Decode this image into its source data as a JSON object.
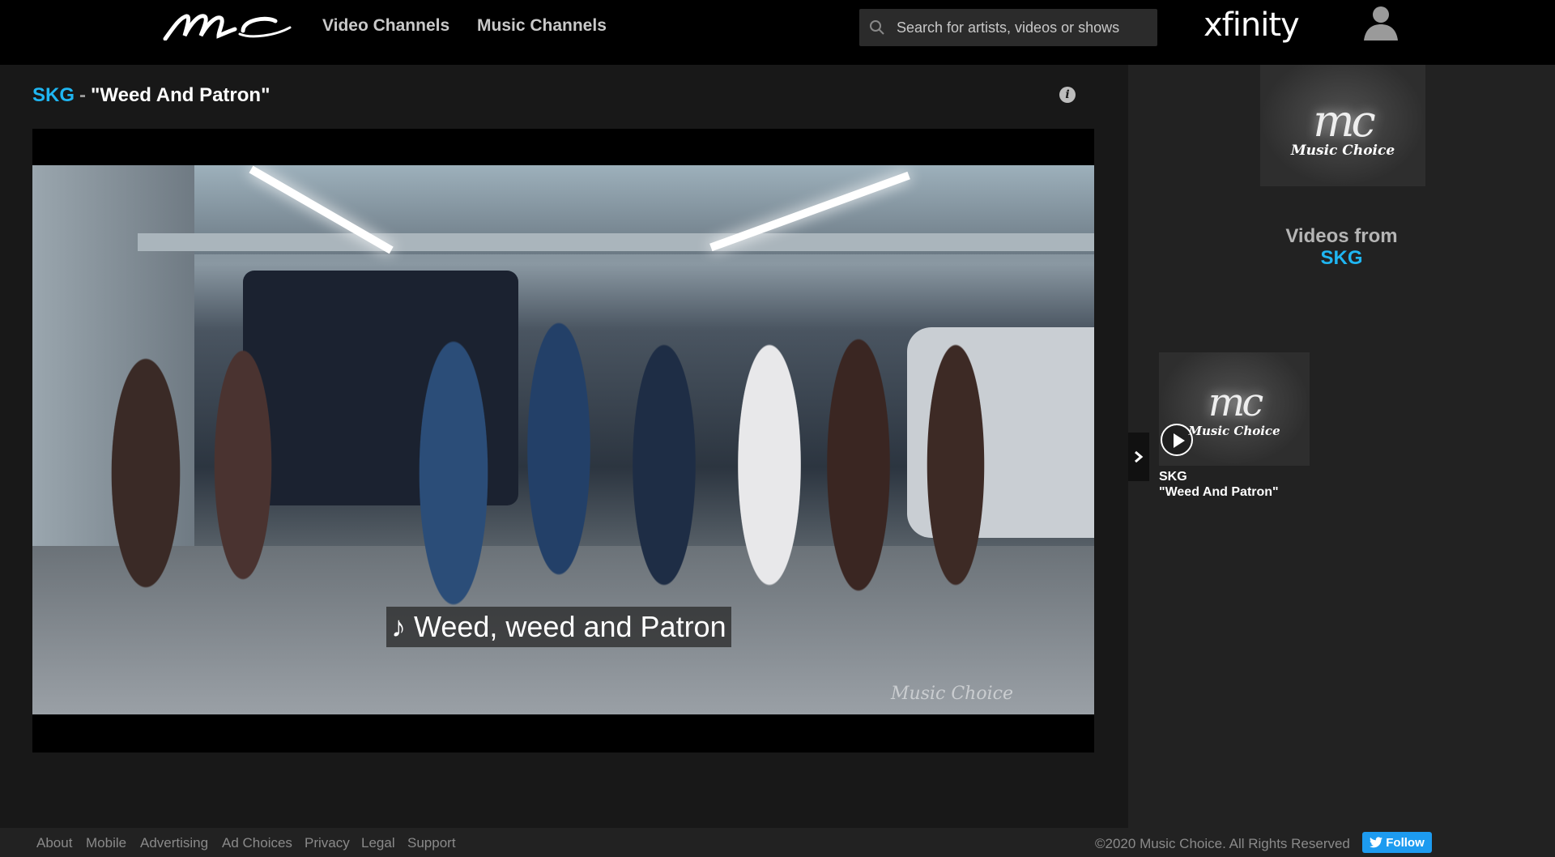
{
  "header": {
    "logo_text": "mc",
    "nav": [
      {
        "label": "Video Channels"
      },
      {
        "label": "Music Channels"
      }
    ],
    "search": {
      "placeholder": "Search for artists, videos or shows",
      "value": ""
    },
    "brand": "xfinity",
    "icons": {
      "search": "search-icon",
      "profile": "user-icon"
    }
  },
  "main": {
    "artist": "SKG",
    "separator": "-",
    "song_title": "\"Weed And Patron\"",
    "info_icon": "i",
    "player": {
      "caption": "♪ Weed, weed and Patron",
      "watermark": "Music Choice"
    }
  },
  "sidebar": {
    "top_card": {
      "logo": "mc",
      "sub": "Music Choice"
    },
    "videos_from_label": "Videos from",
    "videos_from_artist": "SKG",
    "videos": [
      {
        "logo": "mc",
        "sub": "Music Choice",
        "artist": "SKG",
        "title": "\"Weed And Patron\""
      }
    ]
  },
  "footer": {
    "links": [
      "About",
      "Mobile",
      "Advertising",
      "Ad Choices",
      "Privacy",
      "Legal",
      "Support"
    ],
    "copyright": "©2020 Music Choice. All Rights Reserved",
    "follow_label": "Follow"
  },
  "colors": {
    "accent": "#1fb6f2",
    "twitter": "#1d9bf0",
    "bg": "#181818",
    "sidebar": "#222222"
  }
}
